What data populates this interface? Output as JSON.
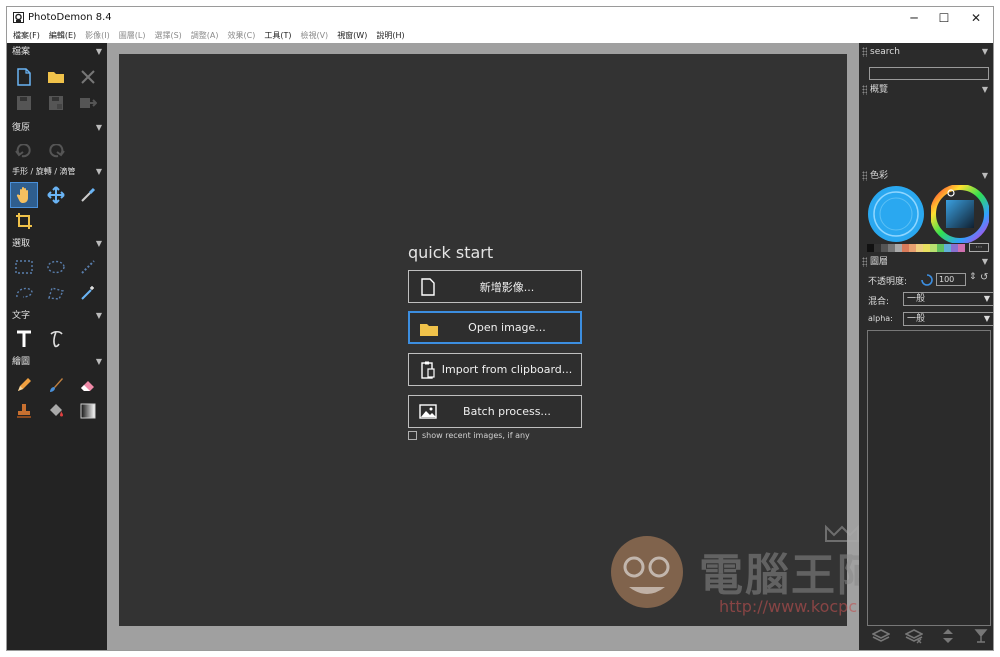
{
  "window": {
    "title": "PhotoDemon 8.4",
    "minimize": "─",
    "maximize": "☐",
    "close": "✕"
  },
  "menu": [
    {
      "label": "檔案(F)",
      "enabled": true
    },
    {
      "label": "編輯(E)",
      "enabled": true
    },
    {
      "label": "影像(I)",
      "enabled": false
    },
    {
      "label": "圖層(L)",
      "enabled": false
    },
    {
      "label": "選擇(S)",
      "enabled": false
    },
    {
      "label": "調整(A)",
      "enabled": false
    },
    {
      "label": "效果(C)",
      "enabled": false
    },
    {
      "label": "工具(T)",
      "enabled": true
    },
    {
      "label": "檢視(V)",
      "enabled": false
    },
    {
      "label": "視窗(W)",
      "enabled": true
    },
    {
      "label": "說明(H)",
      "enabled": true
    }
  ],
  "toolbox": {
    "file": "檔案",
    "undo": "復原",
    "hand": "手形 / 旋轉 / 滴管",
    "select": "選取",
    "text": "文字",
    "paint": "繪圖"
  },
  "quickstart": {
    "title": "quick start",
    "new_image": "新增影像...",
    "open_image": "Open image...",
    "import_clipboard": "Import from clipboard...",
    "batch": "Batch process...",
    "recent": "show recent images, if any"
  },
  "watermark": {
    "name": "電腦王阿達",
    "url": "http://www.kocpc.com.tw"
  },
  "right_panel": {
    "search": "search",
    "overview": "概覽",
    "color": "色彩",
    "layers": "圖層",
    "opacity_label": "不透明度:",
    "opacity_value": "100",
    "blend_label": "混合:",
    "blend_value": "一般",
    "alpha_label": "alpha:",
    "alpha_value": "一般",
    "palette_more": "⋯"
  },
  "colors": {
    "accent": "#3c8ee0",
    "primary_color": "#2aa8f0",
    "palette": [
      "#111111",
      "#333333",
      "#555555",
      "#777777",
      "#aaaaaa",
      "#d97b5a",
      "#e8a070",
      "#f0d080",
      "#e8e060",
      "#b8e070",
      "#60c060",
      "#60b0d8",
      "#8870d0",
      "#d070b0"
    ]
  }
}
